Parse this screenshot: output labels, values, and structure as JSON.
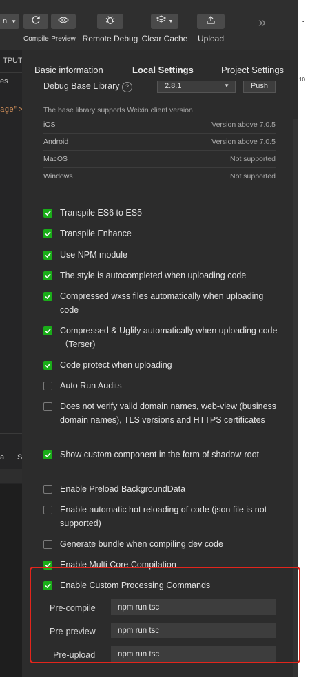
{
  "toolbar": {
    "compile_label": "Compile",
    "preview_label": "Preview",
    "remote_debug_label": "Remote Debug",
    "clear_cache_label": "Clear Cache",
    "upload_label": "Upload",
    "more_glyph": "»",
    "mode_dropdown_partial": "n"
  },
  "left_strip": {
    "output_label": "TPUT",
    "es_label": "es",
    "code_fragment": "age\">",
    "tab_a": "a",
    "tab_s": "S"
  },
  "right_strip": {
    "number": "10",
    "caret": "⌄"
  },
  "tabs": [
    {
      "label": "Basic information",
      "active": false
    },
    {
      "label": "Local Settings",
      "active": true
    },
    {
      "label": "Project Settings",
      "active": false
    }
  ],
  "debug_library": {
    "label": "Debug Base Library",
    "version": "2.8.1",
    "push_label": "Push"
  },
  "support": {
    "heading": "The base library supports Weixin client version",
    "rows": [
      {
        "platform": "iOS",
        "status": "Version above 7.0.5"
      },
      {
        "platform": "Android",
        "status": "Version above 7.0.5"
      },
      {
        "platform": "MacOS",
        "status": "Not supported"
      },
      {
        "platform": "Windows",
        "status": "Not supported"
      }
    ]
  },
  "options": [
    {
      "label": "Transpile ES6 to ES5",
      "checked": true
    },
    {
      "label": "Transpile Enhance",
      "checked": true
    },
    {
      "label": "Use NPM module",
      "checked": true
    },
    {
      "label": "The style is autocompleted when uploading code",
      "checked": true
    },
    {
      "label": "Compressed wxss files automatically when uploading code",
      "checked": true
    },
    {
      "label": "Compressed & Uglify automatically when uploading code （Terser)",
      "checked": true
    },
    {
      "label": "Code protect when uploading",
      "checked": true
    },
    {
      "label": "Auto Run Audits",
      "checked": false
    },
    {
      "label": "Does not verify valid domain names, web-view (business domain names), TLS versions and HTTPS certificates",
      "checked": false
    },
    {
      "label": "Show custom component in the form of shadow-root",
      "checked": true
    },
    {
      "label": "Enable Preload BackgroundData",
      "checked": false
    },
    {
      "label": "Enable automatic hot reloading of code (json file is not supported)",
      "checked": false
    },
    {
      "label": "Generate bundle when compiling dev code",
      "checked": false
    },
    {
      "label": "Enable Multi Core Compilation",
      "checked": true
    },
    {
      "label": "Enable Custom Processing Commands",
      "checked": true
    }
  ],
  "commands": [
    {
      "label": "Pre-compile",
      "value": "npm run tsc"
    },
    {
      "label": "Pre-preview",
      "value": "npm run tsc"
    },
    {
      "label": "Pre-upload",
      "value": "npm run tsc"
    }
  ],
  "colors": {
    "checkbox_green": "#1aad19",
    "highlight_red": "#e2251c",
    "panel_bg": "#2c2c2c"
  }
}
